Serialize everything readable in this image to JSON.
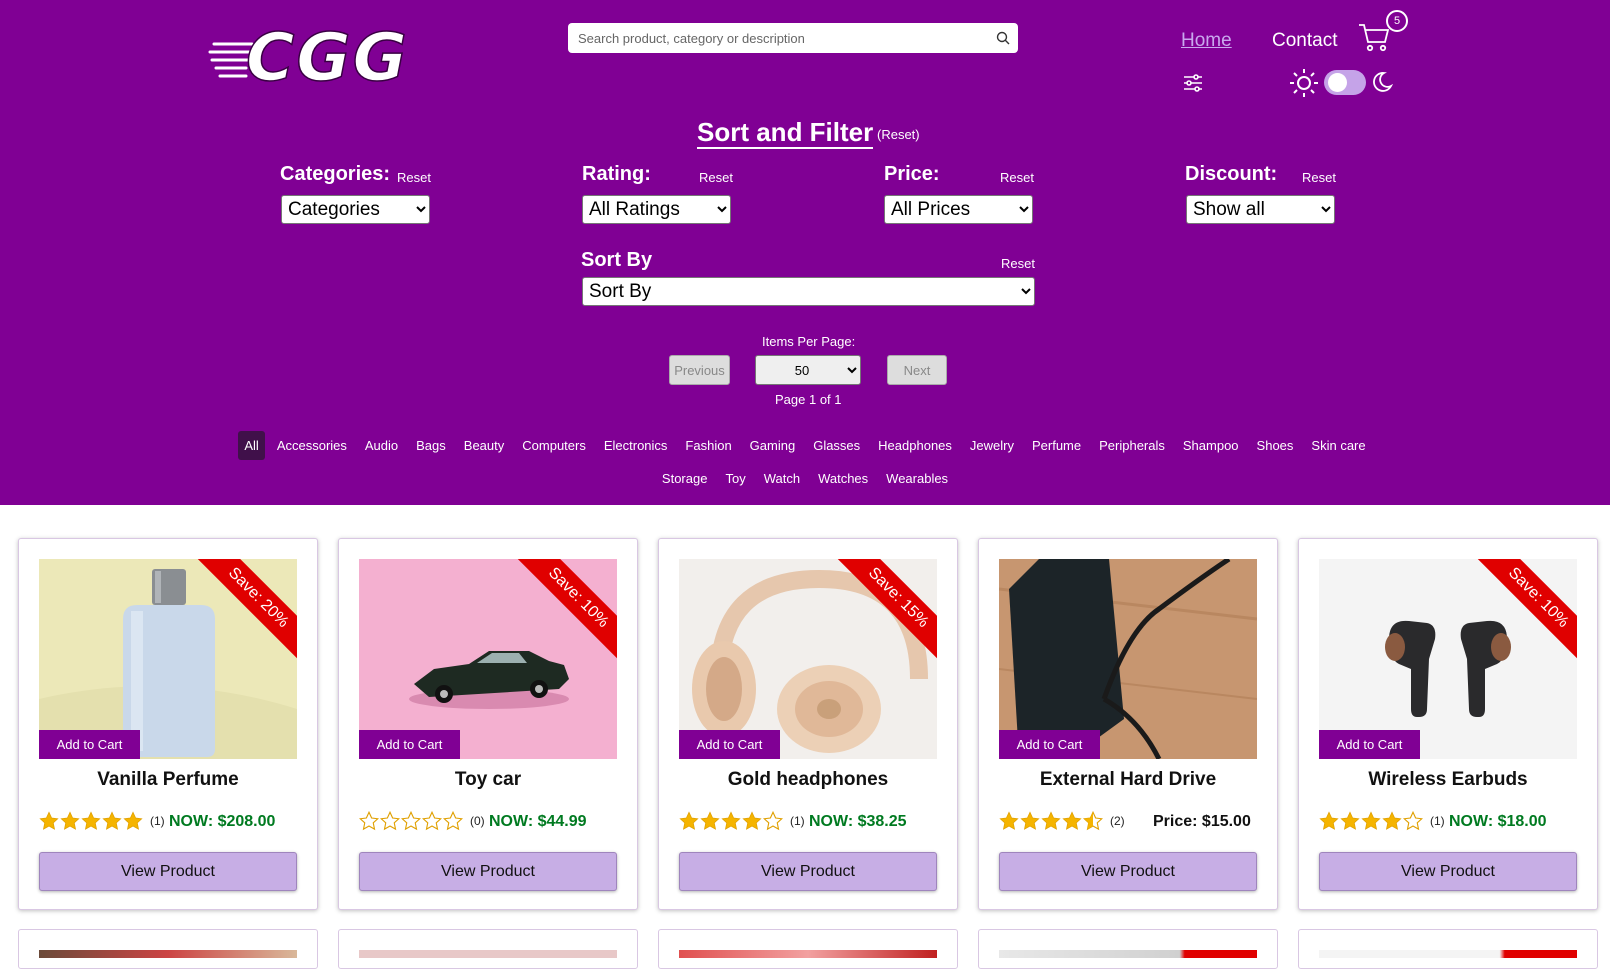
{
  "header": {
    "logo_text": "CGG",
    "search_placeholder": "Search product, category or description",
    "nav_home": "Home",
    "nav_contact": "Contact",
    "cart_count": "5"
  },
  "sort_filter": {
    "title": "Sort and Filter",
    "reset_all": "(Reset)",
    "categories": {
      "label": "Categories:",
      "reset": "Reset",
      "selected": "Categories"
    },
    "rating": {
      "label": "Rating:",
      "reset": "Reset",
      "selected": "All Ratings"
    },
    "price": {
      "label": "Price:",
      "reset": "Reset",
      "selected": "All Prices"
    },
    "discount": {
      "label": "Discount:",
      "reset": "Reset",
      "selected": "Show all"
    },
    "sort_by": {
      "label": "Sort By",
      "reset": "Reset",
      "selected": "Sort By"
    }
  },
  "pagination": {
    "items_per_page_label": "Items Per Page:",
    "previous": "Previous",
    "next": "Next",
    "items_per_page": "50",
    "page_info": "Page 1 of 1"
  },
  "category_tabs_row1": [
    "All",
    "Accessories",
    "Audio",
    "Bags",
    "Beauty",
    "Computers",
    "Electronics",
    "Fashion",
    "Gaming",
    "Glasses",
    "Headphones",
    "Jewelry",
    "Perfume",
    "Peripherals",
    "Shampoo",
    "Shoes",
    "Skin care"
  ],
  "category_tabs_row2": [
    "Storage",
    "Toy",
    "Watch",
    "Watches",
    "Wearables"
  ],
  "active_category": "All",
  "products": [
    {
      "name": "Vanilla Perfume",
      "rating": 5,
      "reviews": "(1)",
      "price": "NOW: $208.00",
      "discount": "Save: 20%",
      "on_sale": true,
      "add_to_cart": "Add to Cart",
      "view": "View Product",
      "image": "perfume-bottle"
    },
    {
      "name": "Toy car",
      "rating": 0,
      "reviews": "(0)",
      "price": "NOW: $44.99",
      "discount": "Save: 10%",
      "on_sale": true,
      "add_to_cart": "Add to Cart",
      "view": "View Product",
      "image": "toy-car"
    },
    {
      "name": "Gold headphones",
      "rating": 4,
      "reviews": "(1)",
      "price": "NOW: $38.25",
      "discount": "Save: 15%",
      "on_sale": true,
      "add_to_cart": "Add to Cart",
      "view": "View Product",
      "image": "headphones"
    },
    {
      "name": "External Hard Drive",
      "rating": 4.5,
      "reviews": "(2)",
      "price": "Price: $15.00",
      "discount": "",
      "on_sale": false,
      "add_to_cart": "Add to Cart",
      "view": "View Product",
      "image": "hard-drive"
    },
    {
      "name": "Wireless Earbuds",
      "rating": 4,
      "reviews": "(1)",
      "price": "NOW: $18.00",
      "discount": "Save: 10%",
      "on_sale": true,
      "add_to_cart": "Add to Cart",
      "view": "View Product",
      "image": "earbuds"
    }
  ],
  "colors": {
    "header_bg": "#800094",
    "button_bg": "#c7aee5",
    "sale_price": "#007a20",
    "ribbon": "#e00000",
    "star": "#f5b400"
  }
}
